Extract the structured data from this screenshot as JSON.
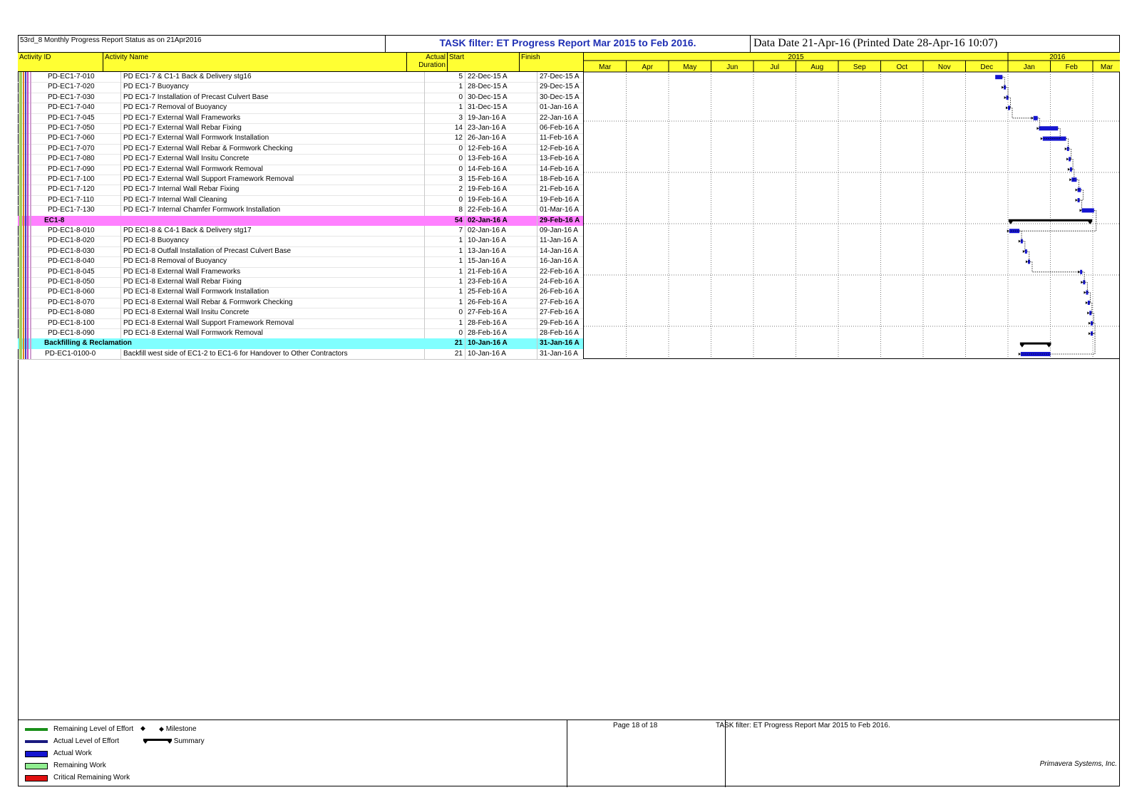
{
  "header": {
    "left": "53rd_8 Monthly Progress Report Status as on 21Apr2016",
    "middle": "TASK filter: ET Progress Report Mar 2015 to Feb 2016.",
    "right": "Data Date 21-Apr-16 (Printed Date 28-Apr-16 10:07)"
  },
  "columns": {
    "activity_id": "Activity ID",
    "activity_name": "Activity Name",
    "actual_duration": "Actual Duration",
    "start": "Start",
    "finish": "Finish"
  },
  "timescale": {
    "years": [
      {
        "label": "2015",
        "from": 0,
        "to": 10
      },
      {
        "label": "2016",
        "from": 10,
        "to": 12.33
      }
    ],
    "months": [
      "Mar",
      "Apr",
      "May",
      "Jun",
      "Jul",
      "Aug",
      "Sep",
      "Oct",
      "Nov",
      "Dec",
      "Jan",
      "Feb",
      "Mar"
    ]
  },
  "rows": [
    {
      "kind": "task",
      "id": "PD-EC1-7-010",
      "name": "PD EC1-7 & C1-1 Back & Delivery stg16",
      "dur": "5",
      "start": "22-Dec-15 A",
      "finish": "27-Dec-15 A",
      "s": 9.7,
      "f": 9.87
    },
    {
      "kind": "task",
      "id": "PD-EC1-7-020",
      "name": "PD EC1-7 Buoyancy",
      "dur": "1",
      "start": "28-Dec-15 A",
      "finish": "29-Dec-15 A",
      "s": 9.9,
      "f": 9.95
    },
    {
      "kind": "task",
      "id": "PD-EC1-7-030",
      "name": "PD EC1-7 Installation of Precast Culvert Base",
      "dur": "0",
      "start": "30-Dec-15 A",
      "finish": "30-Dec-15 A",
      "s": 9.96,
      "f": 9.99
    },
    {
      "kind": "task",
      "id": "PD-EC1-7-040",
      "name": "PD EC1-7 Removal of Buoyancy",
      "dur": "1",
      "start": "31-Dec-15 A",
      "finish": "01-Jan-16 A",
      "s": 10.0,
      "f": 10.05
    },
    {
      "kind": "task",
      "id": "PD-EC1-7-045",
      "name": "PD EC1-7 External Wall Frameworks",
      "dur": "3",
      "start": "19-Jan-16 A",
      "finish": "22-Jan-16 A",
      "s": 10.6,
      "f": 10.7
    },
    {
      "kind": "task",
      "id": "PD-EC1-7-050",
      "name": "PD EC1-7 External Wall Rebar Fixing",
      "dur": "14",
      "start": "23-Jan-16 A",
      "finish": "06-Feb-16 A",
      "s": 10.73,
      "f": 11.18
    },
    {
      "kind": "task",
      "id": "PD-EC1-7-060",
      "name": "PD EC1-7 External Wall Formwork Installation",
      "dur": "12",
      "start": "26-Jan-16 A",
      "finish": "11-Feb-16 A",
      "s": 10.82,
      "f": 11.37
    },
    {
      "kind": "task",
      "id": "PD-EC1-7-070",
      "name": "PD EC1-7 External Wall Rebar & Formwork Checking",
      "dur": "0",
      "start": "12-Feb-16 A",
      "finish": "12-Feb-16 A",
      "s": 11.39,
      "f": 11.42
    },
    {
      "kind": "task",
      "id": "PD-EC1-7-080",
      "name": "PD EC1-7 External Wall Insitu Concrete",
      "dur": "0",
      "start": "13-Feb-16 A",
      "finish": "13-Feb-16 A",
      "s": 11.43,
      "f": 11.46
    },
    {
      "kind": "task",
      "id": "PD-EC1-7-090",
      "name": "PD EC1-7 External Wall Formwork Removal",
      "dur": "0",
      "start": "14-Feb-16 A",
      "finish": "14-Feb-16 A",
      "s": 11.46,
      "f": 11.49
    },
    {
      "kind": "task",
      "id": "PD-EC1-7-100",
      "name": "PD EC1-7 External Wall Support Framework Removal",
      "dur": "3",
      "start": "15-Feb-16 A",
      "finish": "18-Feb-16 A",
      "s": 11.5,
      "f": 11.62
    },
    {
      "kind": "task",
      "id": "PD-EC1-7-120",
      "name": "PD EC1-7 Internal Wall Rebar Fixing",
      "dur": "2",
      "start": "19-Feb-16 A",
      "finish": "21-Feb-16 A",
      "s": 11.64,
      "f": 11.72
    },
    {
      "kind": "task",
      "id": "PD-EC1-7-110",
      "name": "PD EC1-7 Internal Wall Cleaning",
      "dur": "0",
      "start": "19-Feb-16 A",
      "finish": "19-Feb-16 A",
      "s": 11.64,
      "f": 11.67
    },
    {
      "kind": "task",
      "id": "PD-EC1-7-130",
      "name": "PD EC1-7 Internal Chamfer Formwork Installation",
      "dur": "8",
      "start": "22-Feb-16 A",
      "finish": "01-Mar-16 A",
      "s": 11.74,
      "f": 12.03
    },
    {
      "kind": "group",
      "style": "pink",
      "label": "EC1-8",
      "dur": "54",
      "start": "02-Jan-16 A",
      "finish": "29-Feb-16 A",
      "s": 10.03,
      "f": 11.97
    },
    {
      "kind": "task",
      "id": "PD-EC1-8-010",
      "name": "PD EC1-8 & C4-1 Back & Delivery stg17",
      "dur": "7",
      "start": "02-Jan-16 A",
      "finish": "09-Jan-16 A",
      "s": 10.03,
      "f": 10.27
    },
    {
      "kind": "task",
      "id": "PD-EC1-8-020",
      "name": "PD EC1-8 Buoyancy",
      "dur": "1",
      "start": "10-Jan-16 A",
      "finish": "11-Jan-16 A",
      "s": 10.3,
      "f": 10.34
    },
    {
      "kind": "task",
      "id": "PD-EC1-8-030",
      "name": "PD EC1-8 Outfall Installation of Precast Culvert Base",
      "dur": "1",
      "start": "13-Jan-16 A",
      "finish": "14-Jan-16 A",
      "s": 10.4,
      "f": 10.44
    },
    {
      "kind": "task",
      "id": "PD-EC1-8-040",
      "name": "PD EC1-8 Removal of Buoyancy",
      "dur": "1",
      "start": "15-Jan-16 A",
      "finish": "16-Jan-16 A",
      "s": 10.47,
      "f": 10.51
    },
    {
      "kind": "task",
      "id": "PD-EC1-8-045",
      "name": "PD EC1-8 External Wall Frameworks",
      "dur": "1",
      "start": "21-Feb-16 A",
      "finish": "22-Feb-16 A",
      "s": 11.7,
      "f": 11.74
    },
    {
      "kind": "task",
      "id": "PD-EC1-8-050",
      "name": "PD EC1-8 External Wall Rebar Fixing",
      "dur": "1",
      "start": "23-Feb-16 A",
      "finish": "24-Feb-16 A",
      "s": 11.77,
      "f": 11.81
    },
    {
      "kind": "task",
      "id": "PD-EC1-8-060",
      "name": "PD EC1-8 External Wall Formwork Installation",
      "dur": "1",
      "start": "25-Feb-16 A",
      "finish": "26-Feb-16 A",
      "s": 11.84,
      "f": 11.88
    },
    {
      "kind": "task",
      "id": "PD-EC1-8-070",
      "name": "PD EC1-8 External Wall Rebar & Formwork Checking",
      "dur": "1",
      "start": "26-Feb-16 A",
      "finish": "27-Feb-16 A",
      "s": 11.88,
      "f": 11.92
    },
    {
      "kind": "task",
      "id": "PD-EC1-8-080",
      "name": "PD EC1-8 External Wall Insitu Concrete",
      "dur": "0",
      "start": "27-Feb-16 A",
      "finish": "27-Feb-16 A",
      "s": 11.92,
      "f": 11.95
    },
    {
      "kind": "task",
      "id": "PD-EC1-8-100",
      "name": "PD EC1-8 External Wall Support Framework Removal",
      "dur": "1",
      "start": "28-Feb-16 A",
      "finish": "29-Feb-16 A",
      "s": 11.95,
      "f": 11.99
    },
    {
      "kind": "task",
      "id": "PD-EC1-8-090",
      "name": "PD EC1-8 External Wall Formwork Removal",
      "dur": "0",
      "start": "28-Feb-16 A",
      "finish": "28-Feb-16 A",
      "s": 11.95,
      "f": 11.98
    },
    {
      "kind": "group",
      "style": "cyan",
      "label": "Backfilling & Reclamation",
      "dur": "21",
      "start": "10-Jan-16 A",
      "finish": "31-Jan-16 A",
      "s": 10.3,
      "f": 11.0
    },
    {
      "kind": "task",
      "id": "PD-EC1-0100-0",
      "name": "Backfill west side of EC1-2 to EC1-6 for Handover to Other Contractors",
      "dur": "21",
      "start": "10-Jan-16 A",
      "finish": "31-Jan-16 A",
      "s": 10.3,
      "f": 11.0,
      "indent": "small"
    }
  ],
  "legend": {
    "items": [
      {
        "label": "Remaining Level of Effort",
        "color": "#1a8f1a",
        "kind": "line"
      },
      {
        "label": "Actual Level of Effort",
        "color": "#1a1a80",
        "kind": "line"
      },
      {
        "label": "Actual Work",
        "color": "#1515d0",
        "kind": "bar"
      },
      {
        "label": "Remaining Work",
        "color": "#90ee90",
        "kind": "box"
      },
      {
        "label": "Critical Remaining Work",
        "color": "#e01010",
        "kind": "bar"
      }
    ],
    "milestone": "Milestone",
    "summary": "Summary",
    "page": "Page 18 of 18",
    "filter": "TASK filter: ET Progress Report Mar 2015 to Feb 2016.",
    "company": "Primavera Systems, Inc."
  },
  "colors": {
    "header_yellow": "#ffff33",
    "group_pink": "#ff80ff",
    "group_cyan": "#80ffff",
    "actual_bar": "#1515d0",
    "title_blue": "#1f2fb4"
  }
}
